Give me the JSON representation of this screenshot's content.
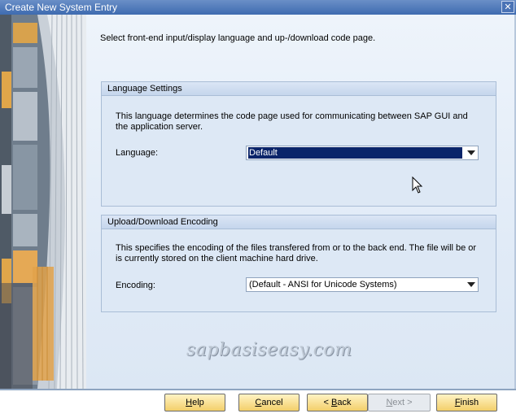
{
  "window": {
    "title": "Create New System Entry"
  },
  "instruction": "Select front-end input/display language and up-/download code page.",
  "language_group": {
    "header": "Language Settings",
    "description": "This language determines the code page used for communicating between SAP GUI and the application server.",
    "label": "Language:",
    "value": "Default"
  },
  "encoding_group": {
    "header": "Upload/Download Encoding",
    "description": "This specifies the encoding of the files transfered from or to the back end. The file will be or is currently stored on the client machine hard drive.",
    "label": "Encoding:",
    "value": "(Default - ANSI for Unicode Systems)"
  },
  "watermark": "sapbasiseasy.com",
  "buttons": {
    "help": {
      "accel": "H",
      "rest": "elp"
    },
    "cancel": {
      "accel": "C",
      "rest": "ancel"
    },
    "back": {
      "pre": "< ",
      "accel": "B",
      "rest": "ack"
    },
    "next": {
      "accel": "N",
      "rest": "ext >"
    },
    "finish": {
      "accel": "F",
      "rest": "inish"
    }
  },
  "icons": {
    "close": "close-icon",
    "dropdown": "chevron-down-icon",
    "cursor": "mouse-pointer-icon"
  },
  "colors": {
    "titlebar": "#3e6bb0",
    "selection": "#0a246a",
    "button": "#f3cf6a",
    "panel_border": "#a9bdd6"
  }
}
